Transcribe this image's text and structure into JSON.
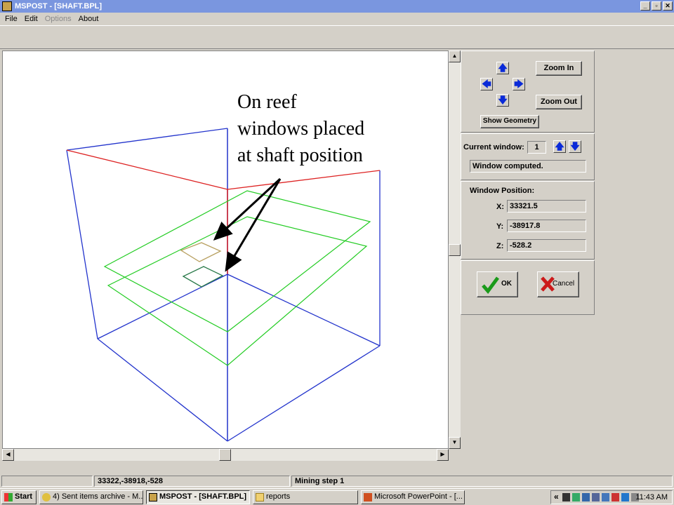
{
  "window": {
    "title": "MSPOST - [SHAFT.BPL]",
    "controls": [
      "_",
      "▫",
      "✕"
    ]
  },
  "menu": {
    "items": [
      {
        "label": "File",
        "enabled": true
      },
      {
        "label": "Edit",
        "enabled": true
      },
      {
        "label": "Options",
        "enabled": false
      },
      {
        "label": "About",
        "enabled": true
      }
    ]
  },
  "annotation": {
    "lines": [
      "On reef",
      "windows placed",
      "at shaft position"
    ]
  },
  "controls": {
    "zoom_in": "Zoom In",
    "zoom_out": "Zoom Out",
    "show_geometry": "Show Geometry",
    "current_window_label": "Current window:",
    "current_window_value": "1",
    "window_status": "Window computed.",
    "position_title": "Window Position:",
    "x_label": "X:",
    "x_value": "33321.5",
    "y_label": "Y:",
    "y_value": "-38917.8",
    "z_label": "Z:",
    "z_value": "-528.2",
    "ok": "OK",
    "cancel": "Cancel"
  },
  "status": {
    "coords": "33322,-38918,-528",
    "mode": "Mining step 1"
  },
  "taskbar": {
    "start": "Start",
    "tasks": [
      {
        "label": "4) Sent items archive - M...",
        "icon": "outlook-icon",
        "active": false
      },
      {
        "label": "MSPOST - [SHAFT.BPL]",
        "icon": "mspost-icon",
        "active": true
      },
      {
        "label": "reports",
        "icon": "folder-icon",
        "active": false
      },
      {
        "label": "Microsoft PowerPoint - [...",
        "icon": "powerpoint-icon",
        "active": false
      }
    ],
    "clock": "11:43 AM"
  },
  "colors": {
    "title_bar": "#7a96df",
    "box_edges": "#2233cc",
    "reef_planes": "#22cc22",
    "shaft": "#dd2222",
    "window_upper": "#b8a060",
    "window_lower": "#2a7a4a",
    "arrow_blue": "#0a2ad8"
  }
}
